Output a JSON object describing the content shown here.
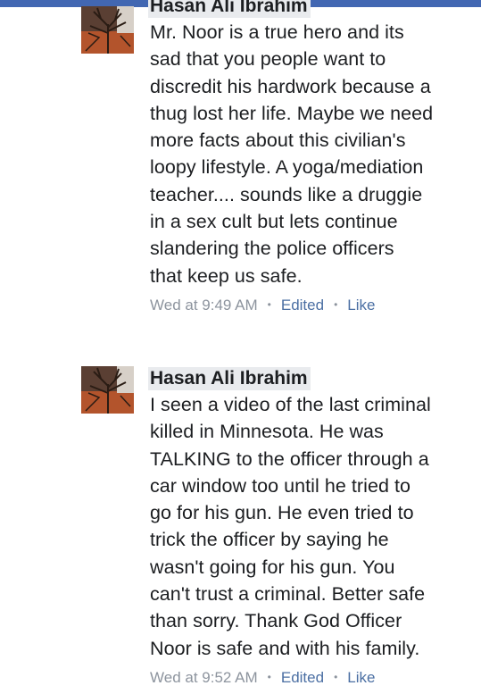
{
  "comments": [
    {
      "author": "Hasan Ali Ibrahim",
      "text": "Mr. Noor is a true hero and its\nsad that you people want to\ndiscredit his hardwork because a\nthug lost her life. Maybe we need\nmore facts about this civilian's\nloopy lifestyle. A yoga/mediation\nteacher.... sounds like a druggie\nin a sex cult but lets continue\nslandering the police officers\nthat keep us safe.",
      "time": "Wed at 9:49 AM",
      "edited_label": "Edited",
      "like_label": "Like"
    },
    {
      "author": "Hasan Ali Ibrahim",
      "text": "I seen a video of the last criminal\nkilled in Minnesota. He was\nTALKING to the officer through a\ncar window too until he tried to\ngo for his gun. He even tried to\ntrick the officer by saying he\nwasn't going for his gun. You\ncan't trust a criminal. Better safe\nthan sorry. Thank God Officer\nNoor is safe and with his family.",
      "time": "Wed at 9:52 AM",
      "edited_label": "Edited",
      "like_label": "Like"
    }
  ],
  "colors": {
    "header_bar": "#4267b2",
    "link": "#4b6fa3",
    "meta_gray": "#8d949e",
    "name_highlight": "#e9ebee"
  }
}
